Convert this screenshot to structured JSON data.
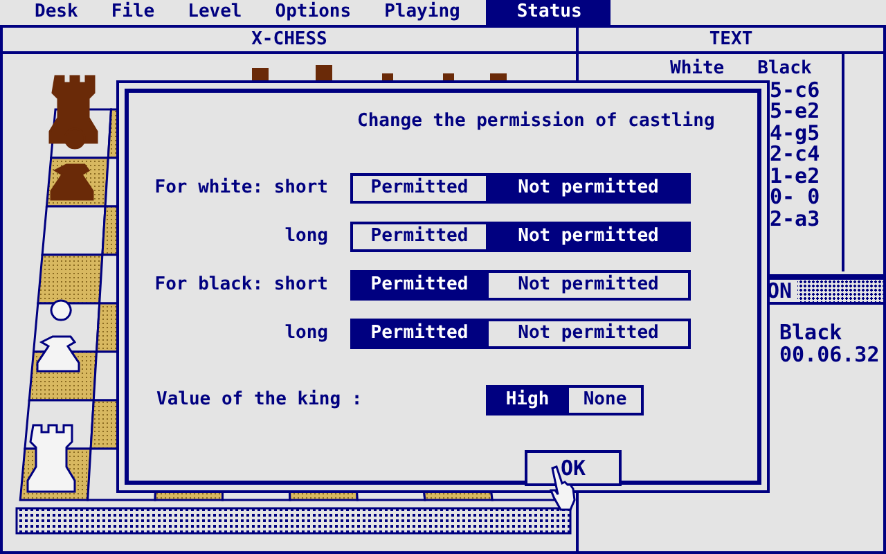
{
  "menu": [
    {
      "label": "Desk",
      "selected": false
    },
    {
      "label": "File",
      "selected": false
    },
    {
      "label": "Level",
      "selected": false
    },
    {
      "label": "Options",
      "selected": false
    },
    {
      "label": "Playing",
      "selected": false
    },
    {
      "label": "Status",
      "selected": true
    }
  ],
  "board_window": {
    "title": "X-CHESS"
  },
  "text_window": {
    "title": "TEXT",
    "header": [
      "White",
      "Black"
    ],
    "moves": [
      "5-c6",
      "5-e2",
      "4-g5",
      "2-c4",
      "1-e2",
      "0- 0",
      "2-a3"
    ]
  },
  "status_window": {
    "title": "ON",
    "player": "Black",
    "time": "00.06.32"
  },
  "dialog": {
    "title": "Change the permission of castling",
    "rows": [
      {
        "label": "For white: short",
        "options": [
          {
            "label": "Permitted",
            "selected": false
          },
          {
            "label": "Not permitted",
            "selected": true
          }
        ]
      },
      {
        "label": "long",
        "options": [
          {
            "label": "Permitted",
            "selected": false
          },
          {
            "label": "Not permitted",
            "selected": true
          }
        ]
      },
      {
        "label": "For black: short",
        "options": [
          {
            "label": "Permitted",
            "selected": true
          },
          {
            "label": "Not permitted",
            "selected": false
          }
        ]
      },
      {
        "label": "long",
        "options": [
          {
            "label": "Permitted",
            "selected": true
          },
          {
            "label": "Not permitted",
            "selected": false
          }
        ]
      }
    ],
    "king": {
      "label": "Value of the king :",
      "options": [
        {
          "label": "High",
          "selected": true
        },
        {
          "label": "None",
          "selected": false
        }
      ]
    },
    "ok_button": "OK"
  }
}
